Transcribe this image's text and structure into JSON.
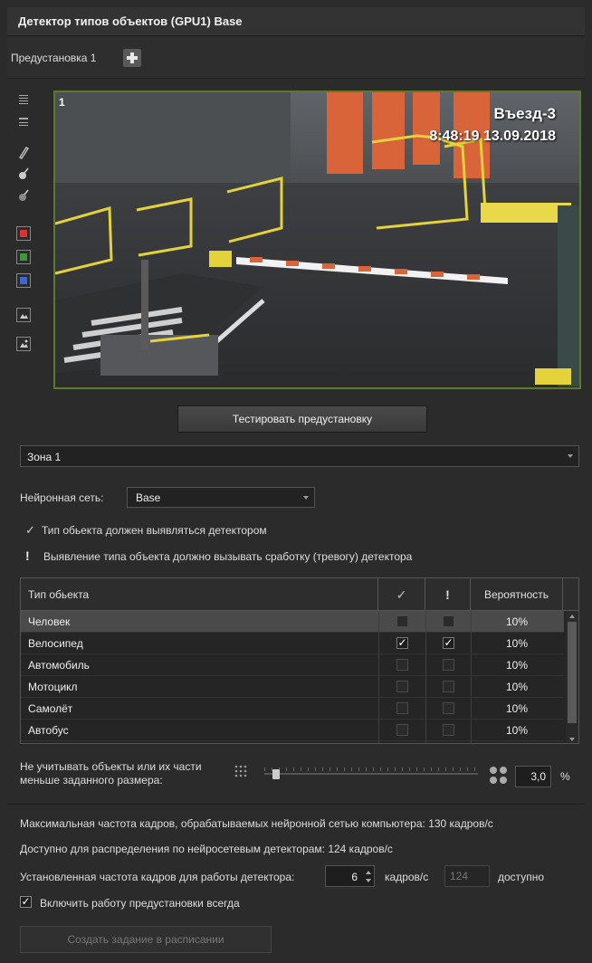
{
  "window": {
    "title": "Детектор типов объектов (GPU1) Base"
  },
  "preset": {
    "label": "Предустановка 1",
    "add_icon": "plus-icon"
  },
  "toolbar": {
    "icons": [
      "grid-fine-icon",
      "grid-coarse-icon",
      "pencil-icon",
      "pencil-erase-icon",
      "pencil-clear-icon",
      "red-square-icon",
      "green-square-icon",
      "blue-square-icon",
      "image-icon",
      "image-edit-icon"
    ],
    "colors": {
      "red": "#e03030",
      "green": "#3a9a3a",
      "blue": "#3a6ad0"
    }
  },
  "video": {
    "number": "1",
    "camera": "Въезд-3",
    "timestamp": "8:48:19  13.09.2018",
    "border_color": "#5b7a2a"
  },
  "test_button": "Тестировать предустановку",
  "zone": {
    "value": "Зона 1"
  },
  "network": {
    "label": "Нейронная сеть:",
    "value": "Base"
  },
  "legend": {
    "check_symbol": "✓",
    "check_text": "Тип обьекта должен выявляться детектором",
    "alarm_symbol": "!",
    "alarm_text": "Выявление типа объекта должно вызывать сработку (тревогу) детектора"
  },
  "table": {
    "headers": {
      "type": "Тип обьекта",
      "detect": "✓",
      "alarm": "!",
      "prob": "Вероятность"
    },
    "rows": [
      {
        "type": "Человек",
        "detect": false,
        "alarm": false,
        "prob": "10%",
        "selected": true
      },
      {
        "type": "Велосипед",
        "detect": true,
        "alarm": true,
        "prob": "10%",
        "selected": false
      },
      {
        "type": "Автомобиль",
        "detect": false,
        "alarm": false,
        "prob": "10%",
        "selected": false
      },
      {
        "type": "Мотоцикл",
        "detect": false,
        "alarm": false,
        "prob": "10%",
        "selected": false
      },
      {
        "type": "Самолёт",
        "detect": false,
        "alarm": false,
        "prob": "10%",
        "selected": false
      },
      {
        "type": "Автобус",
        "detect": false,
        "alarm": false,
        "prob": "10%",
        "selected": false
      }
    ]
  },
  "min_size": {
    "label": "Не учитывать объекты или их части меньше заданного размера:",
    "value": "3,0",
    "unit": "%",
    "slider_fraction": 0.03
  },
  "info": {
    "max_fps": "Максимальная частота кадров, обрабатываемых нейронной сетью компьютера: 130 кадров/с",
    "available": "Доступно для распределения по нейросетевым детекторам: 124 кадров/с"
  },
  "fps": {
    "label": "Установленная частота кадров для работы детектора:",
    "value": "6",
    "unit": "кадров/с",
    "available_value": "124",
    "available_label": "доступно"
  },
  "always": {
    "checked": true,
    "label": "Включить работу предустановки всегда"
  },
  "schedule_button": "Создать задание в расписании"
}
